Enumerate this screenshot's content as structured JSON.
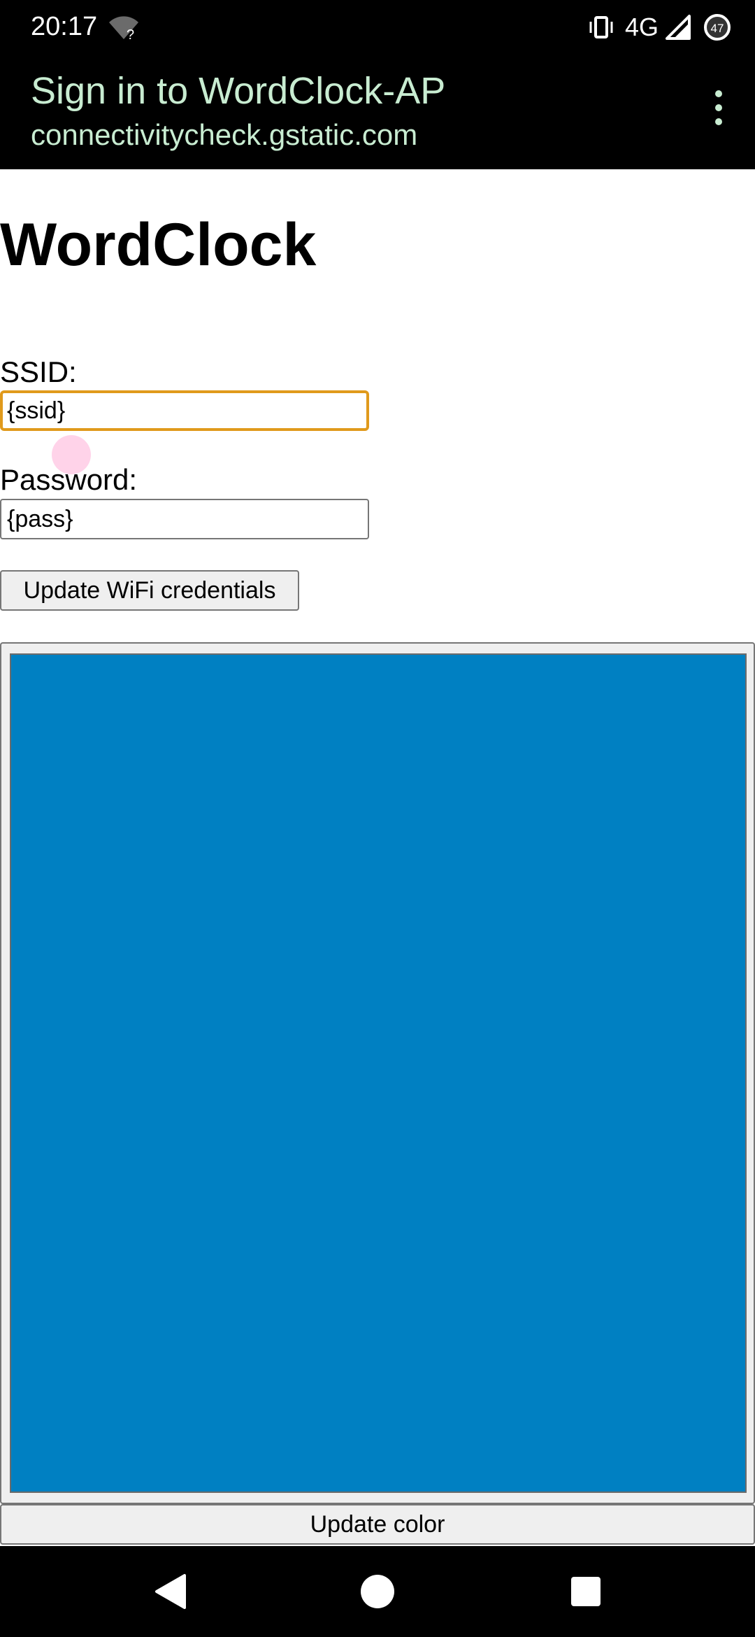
{
  "status_bar": {
    "time": "20:17",
    "wifi_icon": "wifi-no-internet-icon",
    "wifi_badge": "?",
    "vibrate_icon": "vibrate-icon",
    "network": "4G",
    "signal_icon": "signal-icon",
    "battery_level": "47"
  },
  "portal": {
    "title": "Sign in to WordClock-AP",
    "url": "connectivitycheck.gstatic.com",
    "menu_icon": "more-vert-icon",
    "text_color": "#c8ecd1"
  },
  "page": {
    "heading": "WordClock",
    "ssid_label": "SSID:",
    "ssid_value": "{ssid}",
    "password_label": "Password:",
    "password_value": "{pass}",
    "update_wifi_button": "Update WiFi credentials",
    "color_value": "#0080c2",
    "update_color_button": "Update color"
  },
  "nav_bar": {
    "back_icon": "back-icon",
    "home_icon": "home-icon",
    "recents_icon": "recents-icon"
  }
}
